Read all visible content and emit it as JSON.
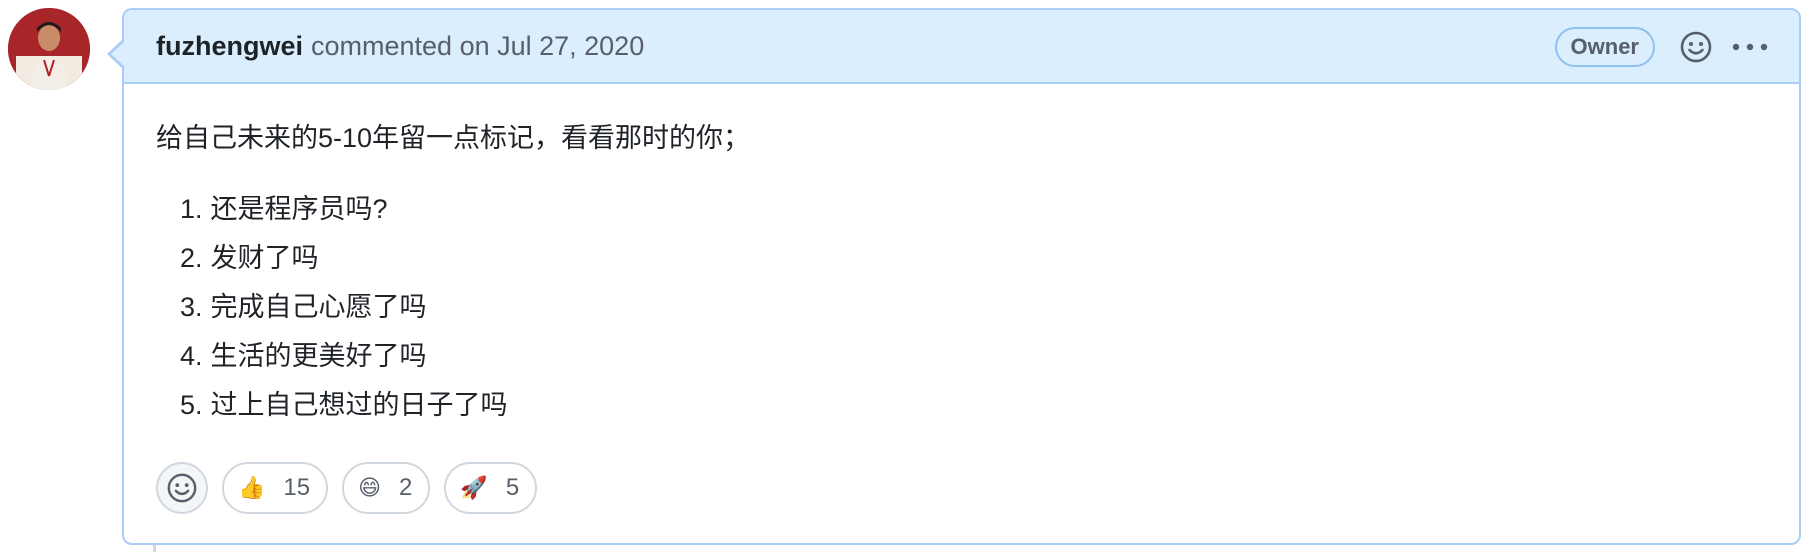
{
  "comment": {
    "author": "fuzhengwei",
    "action": "commented on Jul 27, 2020",
    "badge": "Owner",
    "intro": "给自己未来的5-10年留一点标记，看看那时的你；",
    "items": [
      {
        "num": "1.",
        "text": "还是程序员吗?"
      },
      {
        "num": "2.",
        "text": "发财了吗"
      },
      {
        "num": "3.",
        "text": "完成自己心愿了吗"
      },
      {
        "num": "4.",
        "text": "生活的更美好了吗"
      },
      {
        "num": "5.",
        "text": "过上自己想过的日子了吗"
      }
    ]
  },
  "reactions": [
    {
      "icon": "thumbs-up-icon",
      "emoji": "👍",
      "count": "15"
    },
    {
      "icon": "grinning-face-icon",
      "emoji": "😄",
      "count": "2"
    },
    {
      "icon": "rocket-icon",
      "emoji": "🚀",
      "count": "5"
    }
  ],
  "icons": {
    "header_reaction": "smiley-icon",
    "more": "kebab-horizontal-icon",
    "add_reaction": "smiley-icon"
  },
  "colors": {
    "header_bg": "#dbeefd",
    "border": "#a9cdf6",
    "text": "#1f2328",
    "muted": "#57606a"
  }
}
